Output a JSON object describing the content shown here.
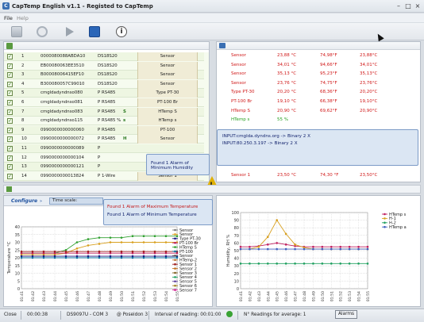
{
  "window": {
    "title": "CapTemp English    v1.1    - Registed to CapTemp",
    "icon_letter": "C"
  },
  "menu": {
    "items": [
      "File",
      "Help"
    ]
  },
  "device_list": {
    "rows": [
      {
        "n": "1",
        "id": "0000080088ABDA10",
        "model": "DS18S20",
        "flag": "",
        "type": "Sensor"
      },
      {
        "n": "2",
        "id": "EB00080063EE3510",
        "model": "DS18S20",
        "flag": "",
        "type": "Sensor"
      },
      {
        "n": "3",
        "id": "B00008006415EF10",
        "model": "DS18S20",
        "flag": "",
        "type": "Sensor"
      },
      {
        "n": "4",
        "id": "B300080057C99010",
        "model": "DS18S20",
        "flag": "",
        "type": "Sensor"
      },
      {
        "n": "5",
        "id": "cmgldadyndnso080",
        "model": "P RS485",
        "flag": "",
        "type": "Type PT-30"
      },
      {
        "n": "6",
        "id": "cmgldadyndnso081",
        "model": "P RS485",
        "flag": "",
        "type": "PT-100 Br"
      },
      {
        "n": "7",
        "id": "cmgldadyndnso083",
        "model": "P RS485",
        "flag": "S",
        "type": "HTemp S"
      },
      {
        "n": "8",
        "id": "cmgldadyndnso115",
        "model": "P RS485 %",
        "flag": "s",
        "type": "HTemp s"
      },
      {
        "n": "9",
        "id": "0990000000000060",
        "model": "P RS485",
        "flag": "",
        "type": "PT-100"
      },
      {
        "n": "10",
        "id": "0990000000000072",
        "model": "P RS485",
        "flag": "H",
        "type": "Sensor"
      },
      {
        "n": "11",
        "id": "0990000000000089",
        "model": "P",
        "flag": "",
        "type": ""
      },
      {
        "n": "12",
        "id": "0990000000000104",
        "model": "P",
        "flag": "",
        "type": ""
      },
      {
        "n": "13",
        "id": "0990000000000121",
        "model": "P",
        "flag": "",
        "type": ""
      },
      {
        "n": "14",
        "id": "0990000000013824",
        "model": "P 1-Wire",
        "flag": "",
        "type": "Sensor 1"
      }
    ]
  },
  "readings": {
    "rows": [
      {
        "name": "Sensor",
        "v1": "23,88 °C",
        "v2": "74,98°F",
        "v3": "23,88°C",
        "color": "#d01818"
      },
      {
        "name": "Sensor",
        "v1": "34,01 °C",
        "v2": "94,66°F",
        "v3": "34,01°C",
        "color": "#d01818"
      },
      {
        "name": "Sensor",
        "v1": "35,13 °C",
        "v2": "95,23°F",
        "v3": "35,13°C",
        "color": "#d01818"
      },
      {
        "name": "Sensor",
        "v1": "23,76 °C",
        "v2": "74,75°F",
        "v3": "23,76°C",
        "color": "#d01818"
      },
      {
        "name": "Type PT-30",
        "v1": "20,20 °C",
        "v2": "68,36°F",
        "v3": "20,20°C",
        "color": "#d01818"
      },
      {
        "name": "PT-100 Br",
        "v1": "19,10 °C",
        "v2": "66,38°F",
        "v3": "19,10°C",
        "color": "#d01818"
      },
      {
        "name": "HTemp S",
        "v1": "20,90 °C",
        "v2": "69,62°F",
        "v3": "20,90°C",
        "color": "#d01818"
      },
      {
        "name": "HTemp s",
        "v1": "55 %",
        "v2": "",
        "v3": "",
        "color": "#27a020"
      }
    ],
    "last_row": {
      "name": "Sensor 1",
      "v1": "23,50 °C",
      "v2": "74,30 °F",
      "v3": "23,50°C"
    }
  },
  "bubbles": {
    "input_lines": [
      "INPUT:cmglda.dyndns.org -> Binary 2 X",
      "INPUT:80.250.3.197 -> Binary 2 X"
    ],
    "humidity_alarm": "Found 1 Alarm of Minimum Humidity",
    "temp_alarms": [
      "Found 1 Alarm of Maximum Temperature",
      "Found 1 Alarm of Minimum Temperature"
    ]
  },
  "config_bar": {
    "configure": "Configure",
    "timescale": "Time scale:"
  },
  "temp_chart": {
    "ylabel": "Temperature °C",
    "legend": [
      "Sensor",
      "Sensor",
      "Type PT-30",
      "PT-100 Br",
      "HTemp S",
      "PT-100",
      "Sensor",
      "HTemp-2",
      "Sensor 1",
      "Sensor 2",
      "Sensor 3",
      "Sensor 4",
      "Sensor 5",
      "Sensor 6",
      "Sensor 7"
    ],
    "legend_colors": [
      "#7a7a7a",
      "#d8a020",
      "#1a1a80",
      "#c02060",
      "#30a030",
      "#0a70a0",
      "#505050",
      "#bb7030",
      "#a02020",
      "#c07020",
      "#806020",
      "#20a060",
      "#6040a0",
      "#a08020",
      "#d02090"
    ]
  },
  "hum_chart": {
    "ylabel": "Humidity, RH %",
    "legend": [
      "HTemp s",
      "H-1",
      "H-2",
      "HTemp a"
    ],
    "legend_colors": [
      "#c02060",
      "#d8a020",
      "#20a060",
      "#4060c0"
    ]
  },
  "chart_data": [
    {
      "type": "line",
      "ylabel": "Temperature °C",
      "ylim": [
        0,
        40
      ],
      "yticks": [
        0,
        5,
        10,
        15,
        20,
        25,
        30,
        35,
        40
      ],
      "categories": [
        "01:41",
        "01:42",
        "01:43",
        "01:44",
        "01:45",
        "01:46",
        "01:47",
        "01:48",
        "01:49",
        "01:50",
        "01:51",
        "01:52",
        "01:53",
        "01:54",
        "01:55"
      ],
      "series": [
        {
          "color": "#30a030",
          "values": [
            23,
            23,
            23,
            23,
            25,
            30,
            32,
            33,
            33,
            33,
            34,
            34,
            34,
            34,
            34
          ]
        },
        {
          "color": "#d8a020",
          "values": [
            22,
            22,
            22,
            22,
            23,
            26,
            28,
            29,
            30,
            30,
            30,
            30,
            30,
            30,
            30
          ]
        },
        {
          "color": "#c02060",
          "values": [
            23,
            23,
            23,
            23,
            23,
            23,
            23,
            23,
            23,
            23,
            23,
            23,
            23,
            23,
            23
          ]
        },
        {
          "color": "#1a1a80",
          "values": [
            21,
            21,
            21,
            21,
            21,
            21,
            21,
            21,
            21,
            21,
            21,
            21,
            21,
            21,
            21
          ]
        },
        {
          "color": "#0a70a0",
          "values": [
            20,
            20,
            20,
            20,
            20,
            20,
            20,
            20,
            20,
            20,
            20,
            20,
            20,
            20,
            20
          ]
        },
        {
          "color": "#a02020",
          "values": [
            24,
            24,
            24,
            24,
            24,
            24,
            24,
            24,
            24,
            24,
            24,
            24,
            24,
            24,
            24
          ]
        }
      ]
    },
    {
      "type": "line",
      "ylabel": "Humidity, RH %",
      "ylim": [
        0,
        100
      ],
      "yticks": [
        0,
        10,
        20,
        30,
        40,
        50,
        60,
        70,
        80,
        90,
        100
      ],
      "categories": [
        "01:41",
        "01:42",
        "01:43",
        "01:44",
        "01:45",
        "01:46",
        "01:47",
        "01:48",
        "01:49",
        "01:50",
        "01:51",
        "01:52",
        "01:53",
        "01:54",
        "01:55"
      ],
      "series": [
        {
          "color": "#c02060",
          "values": [
            55,
            55,
            56,
            58,
            60,
            58,
            56,
            55,
            55,
            55,
            55,
            55,
            55,
            55,
            55
          ]
        },
        {
          "color": "#d8a020",
          "values": [
            52,
            52,
            55,
            68,
            90,
            72,
            58,
            54,
            52,
            52,
            52,
            52,
            52,
            52,
            52
          ]
        },
        {
          "color": "#20a060",
          "values": [
            33,
            33,
            33,
            33,
            33,
            33,
            33,
            33,
            33,
            33,
            33,
            33,
            33,
            33,
            33
          ]
        },
        {
          "color": "#4060c0",
          "values": [
            52,
            52,
            52,
            52,
            52,
            52,
            52,
            52,
            52,
            52,
            52,
            52,
            52,
            52,
            52
          ]
        }
      ]
    }
  ],
  "status": {
    "close": "Close",
    "time": "00:00:38",
    "port": "DS9097U - COM 3",
    "location": "@ Poseidon 3",
    "interval": "Interval of reading: 00:01:00",
    "avg": "N° Readings for average: 1",
    "alarms": "Alarms"
  }
}
